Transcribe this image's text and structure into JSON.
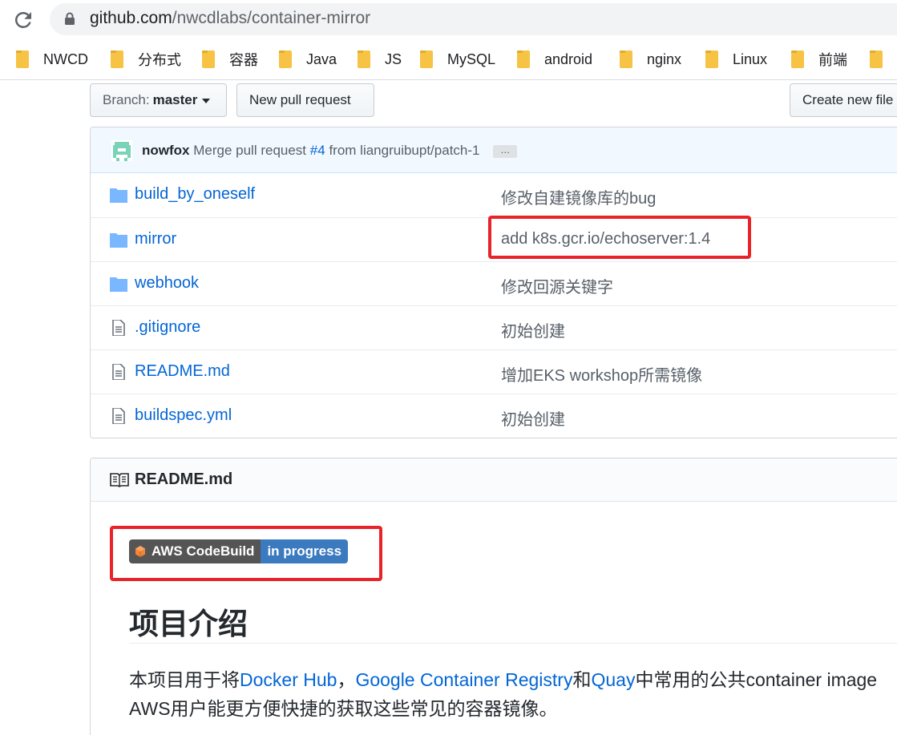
{
  "browser": {
    "url_host": "github.com",
    "url_path": "/nwcdlabs/container-mirror",
    "bookmarks": [
      "NWCD",
      "分布式",
      "容器",
      "Java",
      "JS",
      "MySQL",
      "android",
      "nginx",
      "Linux",
      "前端"
    ]
  },
  "toolbar": {
    "branch_label": "Branch:",
    "branch_value": "master",
    "new_pr_label": "New pull request",
    "create_file_label": "Create new file"
  },
  "commit": {
    "author": "nowfox",
    "message_prefix": "Merge pull request",
    "pr_ref": "#4",
    "message_suffix": "from liangruibupt/patch-1",
    "ellipsis": "…"
  },
  "files": [
    {
      "type": "folder",
      "name": "build_by_oneself",
      "message": "修改自建镜像库的bug"
    },
    {
      "type": "folder",
      "name": "mirror",
      "message": "add k8s.gcr.io/echoserver:1.4"
    },
    {
      "type": "folder",
      "name": "webhook",
      "message": "修改回源关键字"
    },
    {
      "type": "file",
      "name": ".gitignore",
      "message": "初始创建"
    },
    {
      "type": "file",
      "name": "README.md",
      "message": "增加EKS workshop所需镜像"
    },
    {
      "type": "file",
      "name": "buildspec.yml",
      "message": "初始创建"
    }
  ],
  "readme": {
    "title": "README.md",
    "badge_left": "AWS CodeBuild",
    "badge_right": "in progress",
    "heading": "项目介绍",
    "para": {
      "t1": "本项目用于将",
      "link1": "Docker Hub",
      "t2": "，",
      "link2": "Google Container Registry",
      "t3": "和",
      "link3": "Quay",
      "t4": "中常用的公共container image",
      "line2": "AWS用户能更方便快捷的获取这些常见的容器镜像。"
    }
  },
  "colors": {
    "highlight": "#e8242a",
    "link": "#0366d6",
    "folder_icon": "#79b8ff",
    "badge_status": "#3b7abf"
  }
}
